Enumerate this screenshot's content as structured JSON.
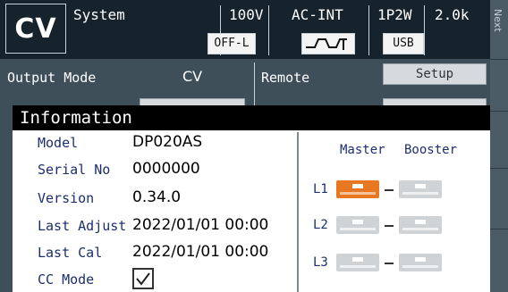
{
  "status": {
    "mode": "CV",
    "menu": "System",
    "voltage_range": "100V",
    "output_state": "OFF-L",
    "source": "AC-INT",
    "phase": "1P2W",
    "range": "2.0k",
    "interface": "USB"
  },
  "softkeys": {
    "next": "Next"
  },
  "settings": {
    "output_mode_label": "Output Mode",
    "output_mode_value": "CV",
    "remote_label": "Remote",
    "setup_label": "Setup"
  },
  "dialog": {
    "title": "Information",
    "model_label": "Model",
    "model_value": "DP020AS",
    "serial_label": "Serial No",
    "serial_value": "0000000",
    "version_label": "Version",
    "version_value": "0.34.0",
    "last_adjust_label": "Last Adjust",
    "last_adjust_value": "2022/01/01 00:00",
    "last_cal_label": "Last Cal",
    "last_cal_value": "2022/01/01 00:00",
    "cc_mode_label": "CC Mode",
    "cc_mode_checked": true
  },
  "units": {
    "master_label": "Master",
    "booster_label": "Booster",
    "lanes": [
      {
        "label": "L1",
        "master_active": true
      },
      {
        "label": "L2",
        "master_active": false
      },
      {
        "label": "L3",
        "master_active": false
      }
    ],
    "active_color": "#e87722",
    "inactive_color": "#cfd3d6"
  }
}
